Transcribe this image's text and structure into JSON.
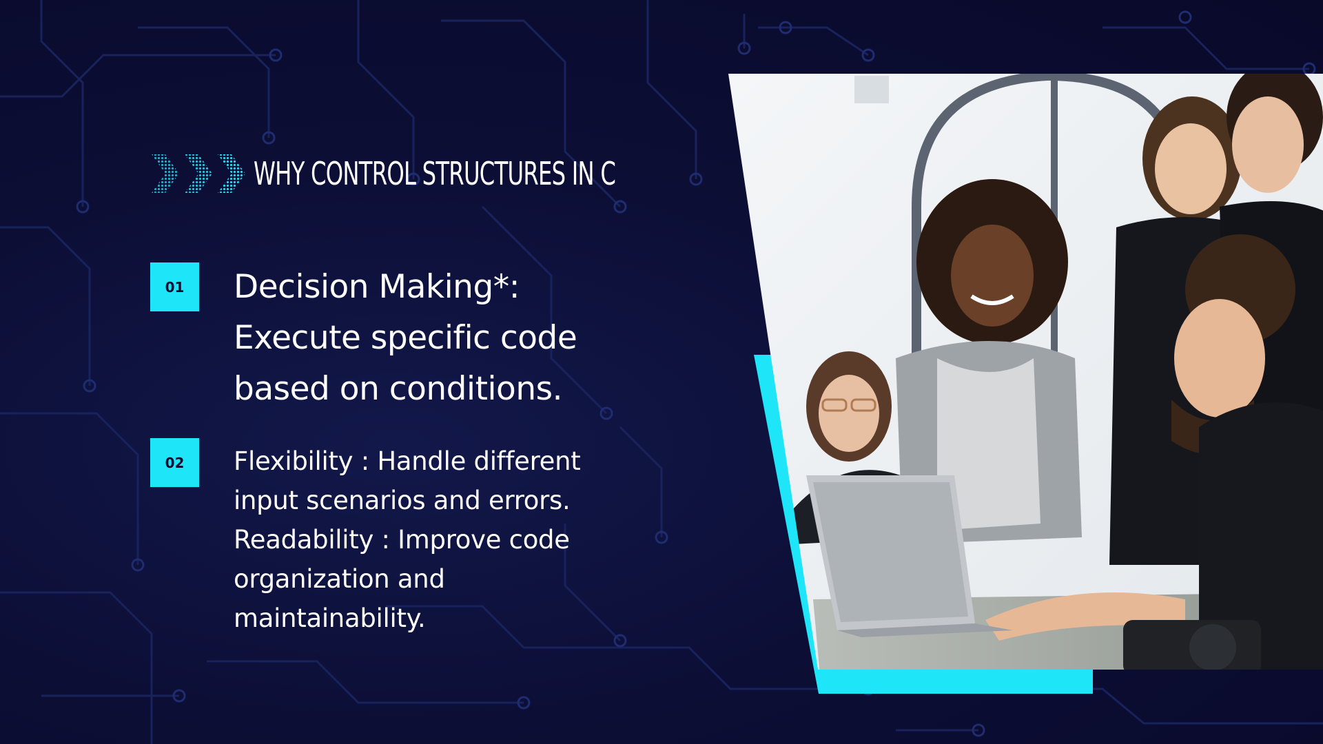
{
  "slide": {
    "heading": "WHY CONTROL STRUCTURES IN C",
    "points": [
      {
        "number": "01",
        "text": "Decision Making*: Execute specific code based on conditions."
      },
      {
        "number": "02",
        "lines": [
          "Flexibility : Handle different input scenarios and errors.",
          "Readability : Improve code organization and maintainability."
        ]
      }
    ]
  },
  "colors": {
    "background": "#0b0c2e",
    "accent": "#1ee5f7",
    "text": "#ffffff"
  },
  "icons": [
    "chevron-right-icon",
    "circuit-pattern"
  ]
}
